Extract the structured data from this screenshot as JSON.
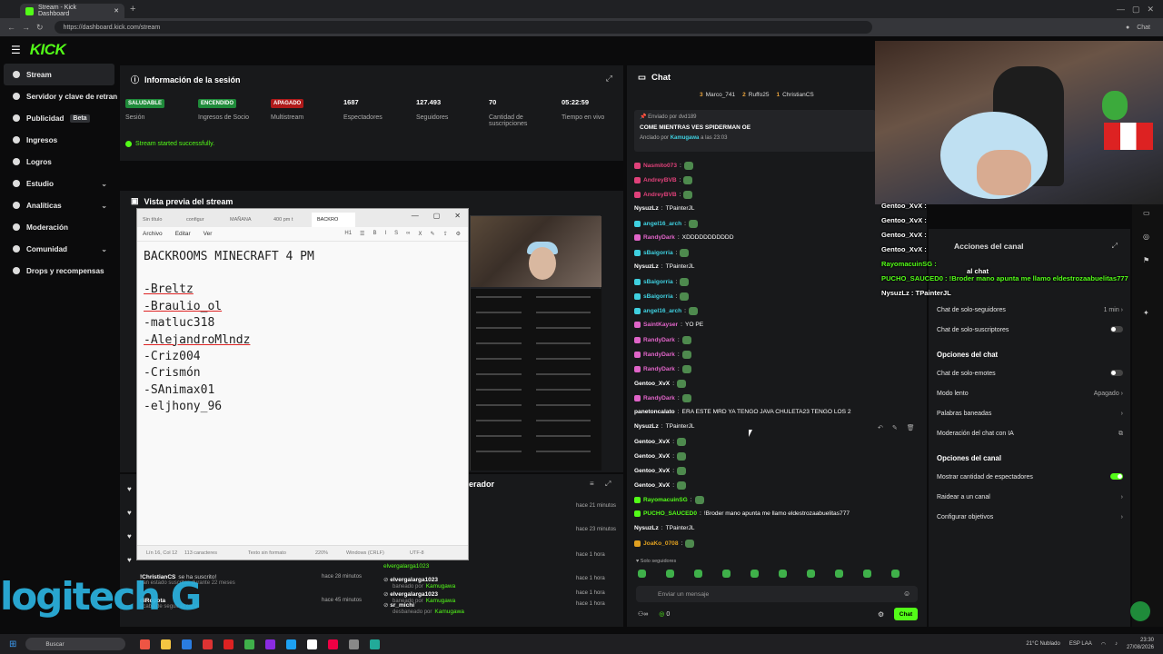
{
  "browser": {
    "tab_title": "Stream - Kick Dashboard",
    "url": "https://dashboard.kick.com/stream",
    "chat_label": "Chat"
  },
  "app": {
    "logo": "KICK"
  },
  "sidebar": {
    "items": [
      {
        "label": "Stream",
        "active": true
      },
      {
        "label": "Servidor y clave de retran"
      },
      {
        "label": "Publicidad",
        "badge": "Beta"
      },
      {
        "label": "Ingresos"
      },
      {
        "label": "Logros"
      },
      {
        "label": "Estudio"
      },
      {
        "label": "Analíticas"
      },
      {
        "label": "Moderación"
      },
      {
        "label": "Comunidad"
      },
      {
        "label": "Drops y recompensas"
      }
    ]
  },
  "session": {
    "title": "Información de la sesión",
    "stats": [
      {
        "value": "SALUDABLE",
        "label": "Sesión",
        "badge": "green"
      },
      {
        "value": "ENCENDIDO",
        "label": "Ingresos de Socio",
        "badge": "green"
      },
      {
        "value": "APAGADO",
        "label": "Multistream",
        "badge": "red"
      },
      {
        "value": "1687",
        "label": "Espectadores"
      },
      {
        "value": "127.493",
        "label": "Seguidores"
      },
      {
        "value": "70",
        "label": "Cantidad de suscripciones"
      },
      {
        "value": "05:22:59",
        "label": "Tiempo en vivo"
      }
    ],
    "started_msg": "Stream started successfully."
  },
  "preview": {
    "title": "Vista previa del stream"
  },
  "notepad": {
    "tabs": [
      "Sin título",
      "configur",
      "MAÑANA",
      "400 pm t",
      "BACKRO"
    ],
    "menu": [
      "Archivo",
      "Editar",
      "Ver"
    ],
    "heading": "BACKROOMS MINECRAFT 4 PM",
    "lines": [
      "-Breltz",
      "-Braulio_ol",
      "-matluc318",
      "-AlejandroMlndz",
      "-Criz004",
      "-Crismón",
      "-SAnimax01",
      "-eljhony_96"
    ],
    "status": {
      "pos": "Lín 16, Col 12",
      "chars": "113 caracteres",
      "format": "Texto sin formato",
      "zoom": "220%",
      "eol": "Windows (CRLF)",
      "enc": "UTF-8"
    }
  },
  "mod_actions": {
    "title": "erador",
    "left": [
      {
        "text": "acaba de seguir el canal",
        "time": ""
      },
      {
        "name": "!ChristianCS",
        "text": "se ha suscrito!",
        "sub": "han estado suscritos durante 22 meses",
        "time": "hace 28 minutos"
      },
      {
        "name": "diRopota",
        "sub": "acaba de seguir el canal",
        "time": "hace 45 minutos"
      }
    ],
    "right": [
      {
        "by": "Kamugawa",
        "time": "hace 21 minutos"
      },
      {
        "by": "",
        "time": "hace 23 minutos"
      },
      {
        "by": "",
        "time": "hace 1 hora"
      },
      {
        "name": "elvergalarga1023",
        "by": "Kamugawa",
        "time": "hace 1 hora",
        "pre": "baneado por"
      },
      {
        "name": "elvergalarga1023",
        "by": "Kamugawa",
        "time": "hace 1 hora",
        "pre": "baneado por"
      },
      {
        "name": "sr_michi",
        "by": "Kamugawa",
        "time": "hace 1 hora",
        "pre": "desbaneado por"
      }
    ],
    "right_top_by": "elvergalarga1023"
  },
  "chat": {
    "title": "Chat",
    "gifters": [
      {
        "name": "Marco_741",
        "n": "3"
      },
      {
        "name": "Ruffo25",
        "n": "2"
      },
      {
        "name": "ChristianCS",
        "n": "1"
      }
    ],
    "pinned": {
      "sent_by": "Enviado por dvd189",
      "message": "COME MIENTRAS VES SPIDERMAN OE",
      "pinned_by": "Anclado por",
      "pinned_user": "Kamugawa",
      "pinned_time": "a las 23:03"
    },
    "messages": [
      {
        "user": "Nasmito073",
        "color": "#e0417a",
        "text": ""
      },
      {
        "user": "AndreyBVB",
        "color": "#e0417a",
        "text": ""
      },
      {
        "user": "AndreyBVB",
        "color": "#e0417a",
        "text": ""
      },
      {
        "user": "NysuzLz",
        "color": "#ffffff",
        "text": "TPainterJL"
      },
      {
        "user": "angel16_arch",
        "color": "#3fd0e0",
        "text": ""
      },
      {
        "user": "RandyDark",
        "color": "#e064c8",
        "text": "XDDDDDDDDDDD"
      },
      {
        "user": "sBaigorria",
        "color": "#3fd0e0",
        "text": ""
      },
      {
        "user": "NysuzLz",
        "color": "#ffffff",
        "text": "TPainterJL"
      },
      {
        "user": "sBaigorria",
        "color": "#3fd0e0",
        "text": ""
      },
      {
        "user": "sBaigorria",
        "color": "#3fd0e0",
        "text": ""
      },
      {
        "user": "angel16_arch",
        "color": "#3fd0e0",
        "text": ""
      },
      {
        "user": "SaintKayser",
        "color": "#e064c8",
        "text": "YO PE"
      },
      {
        "user": "RandyDark",
        "color": "#e064c8",
        "text": ""
      },
      {
        "user": "RandyDark",
        "color": "#e064c8",
        "text": ""
      },
      {
        "user": "RandyDark",
        "color": "#e064c8",
        "text": ""
      },
      {
        "user": "Gentoo_XvX",
        "color": "#ffffff",
        "text": ""
      },
      {
        "user": "RandyDark",
        "color": "#e064c8",
        "text": ""
      },
      {
        "user": "panetoncalato",
        "color": "#ffffff",
        "text": "ERA ESTE MRD YA TENGO JAVA CHULETA23 TENGO LOS 2"
      },
      {
        "user": "NysuzLz",
        "color": "#ffffff",
        "text": "TPainterJL"
      },
      {
        "user": "Gentoo_XvX",
        "color": "#ffffff",
        "text": ""
      },
      {
        "user": "Gentoo_XvX",
        "color": "#ffffff",
        "text": ""
      },
      {
        "user": "Gentoo_XvX",
        "color": "#ffffff",
        "text": ""
      },
      {
        "user": "Gentoo_XvX",
        "color": "#ffffff",
        "text": ""
      },
      {
        "user": "RayomacuinSG",
        "color": "#53fc18",
        "text": ""
      },
      {
        "user": "PUCHO_SAUCED0",
        "color": "#53fc18",
        "text": "!Broder mano apunta me llamo eldestrozaabuelitas777"
      },
      {
        "user": "NysuzLz",
        "color": "#ffffff",
        "text": "TPainterJL"
      },
      {
        "user": "JoaKo_0708",
        "color": "#e0a020",
        "text": ""
      }
    ],
    "solo_label": "Solo seguidores",
    "input_placeholder": "Enviar un mensaje",
    "viewers_small": "0",
    "send_label": "Chat"
  },
  "actions": {
    "title": "Acciones del canal",
    "opts1": [
      {
        "label": "Chat de solo-seguidores",
        "value": "1 min"
      },
      {
        "label": "Chat de solo-suscriptores",
        "toggle": false
      }
    ],
    "sec_chat": "Opciones del chat",
    "opts2": [
      {
        "label": "Chat de solo-emotes",
        "toggle": false
      },
      {
        "label": "Modo lento",
        "value": "Apagado"
      },
      {
        "label": "Palabras baneadas",
        "value": ""
      },
      {
        "label": "Moderación del chat con IA",
        "value": ""
      }
    ],
    "sec_channel": "Opciones del canal",
    "opts3": [
      {
        "label": "Mostrar cantidad de espectadores",
        "toggle": true
      },
      {
        "label": "Raidear a un canal",
        "value": ""
      },
      {
        "label": "Configurar objetivos",
        "value": ""
      }
    ]
  },
  "overlay": {
    "lines": [
      {
        "text": "Gentoo_XvX :",
        "color": "#ffffff"
      },
      {
        "text": "Gentoo_XvX :",
        "color": "#ffffff"
      },
      {
        "text": "Gentoo_XvX :",
        "color": "#ffffff"
      },
      {
        "text": "Gentoo_XvX :",
        "color": "#ffffff"
      },
      {
        "text": "RayomacuinSG :",
        "color": "#53fc18"
      },
      {
        "text": "PUCHO_SAUCED0 : !Broder mano apunta me llamo eldestrozaabuelitas777",
        "color": "#53fc18"
      },
      {
        "text": "NysuzLz : TPainterJL",
        "color": "#ffffff"
      }
    ],
    "follow_tag": "al chat"
  },
  "taskbar": {
    "search": "Buscar",
    "weather": "21°C Nublado",
    "lang": "ESP LAA",
    "time": "23:30",
    "date": "27/08/2026"
  },
  "logitech": "logitech"
}
